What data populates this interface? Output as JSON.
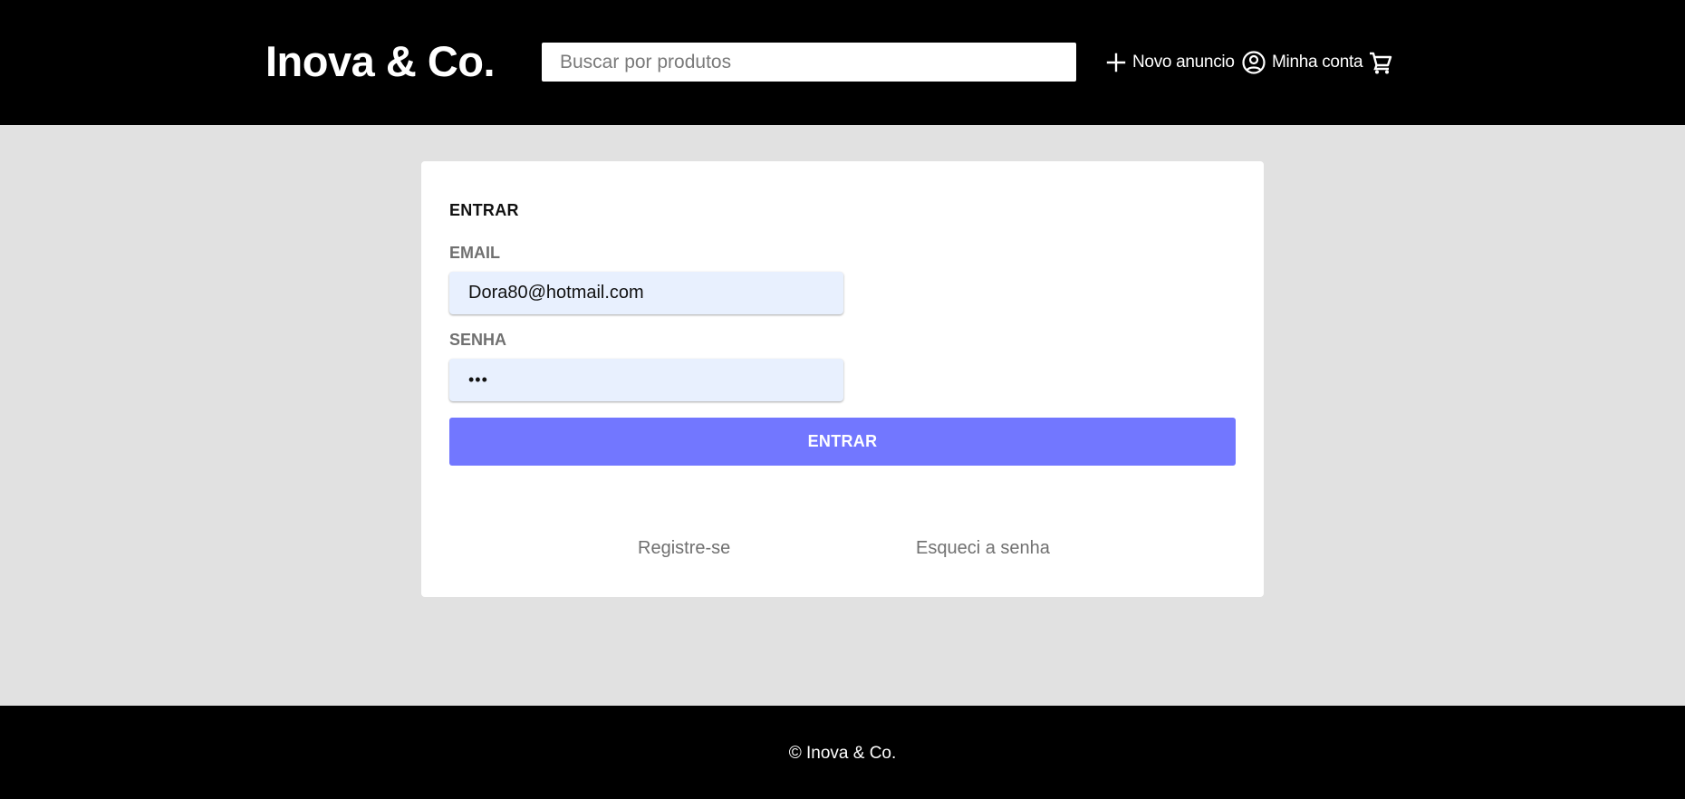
{
  "header": {
    "logo": "Inova & Co.",
    "search": {
      "placeholder": "Buscar por produtos",
      "value": ""
    },
    "nav": {
      "new_ad": {
        "label": "Novo anuncio",
        "icon": "plus-icon"
      },
      "account": {
        "label": "Minha conta",
        "icon": "user-circle-icon"
      },
      "cart": {
        "icon": "cart-icon"
      }
    }
  },
  "login": {
    "title": "ENTRAR",
    "email": {
      "label": "EMAIL",
      "value": "Dora80@hotmail.com"
    },
    "password": {
      "label": "SENHA",
      "value": "•••"
    },
    "submit_label": "ENTRAR",
    "register_link": "Registre-se",
    "forgot_link": "Esqueci a senha"
  },
  "footer": {
    "text": "© Inova & Co."
  },
  "colors": {
    "header_bg": "#000000",
    "page_bg": "#e1e1e1",
    "card_bg": "#ffffff",
    "input_bg": "#e8f0fe",
    "accent": "#7277ff",
    "muted_text": "#707070"
  }
}
